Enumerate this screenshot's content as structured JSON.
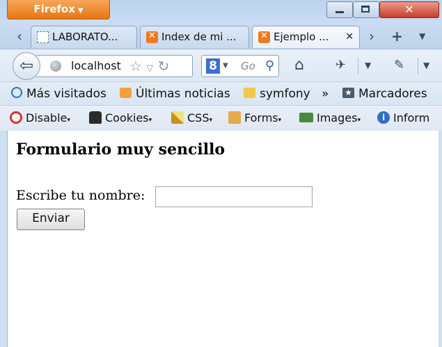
{
  "app": {
    "menu_label": "Firefox"
  },
  "tabs": [
    {
      "label": "LABORATO..."
    },
    {
      "label": "Index de mi ..."
    },
    {
      "label": "Ejemplo ..."
    }
  ],
  "navigation": {
    "url": "localhost",
    "search_placeholder": "Go",
    "search_engine_letter": "8"
  },
  "bookmarks": [
    {
      "label": "Más visitados"
    },
    {
      "label": "Últimas noticias"
    },
    {
      "label": "symfony"
    },
    {
      "label": "Marcadores"
    }
  ],
  "webdev": [
    {
      "label": "Disable"
    },
    {
      "label": "Cookies"
    },
    {
      "label": "CSS"
    },
    {
      "label": "Forms"
    },
    {
      "label": "Images"
    },
    {
      "label": "Inform"
    }
  ],
  "page": {
    "heading": "Formulario muy sencillo",
    "name_label": "Escribe tu nombre:",
    "name_value": "",
    "submit_label": "Enviar"
  },
  "colors": {
    "firefox_button": "#e8750e",
    "close_button": "#c3402a"
  }
}
